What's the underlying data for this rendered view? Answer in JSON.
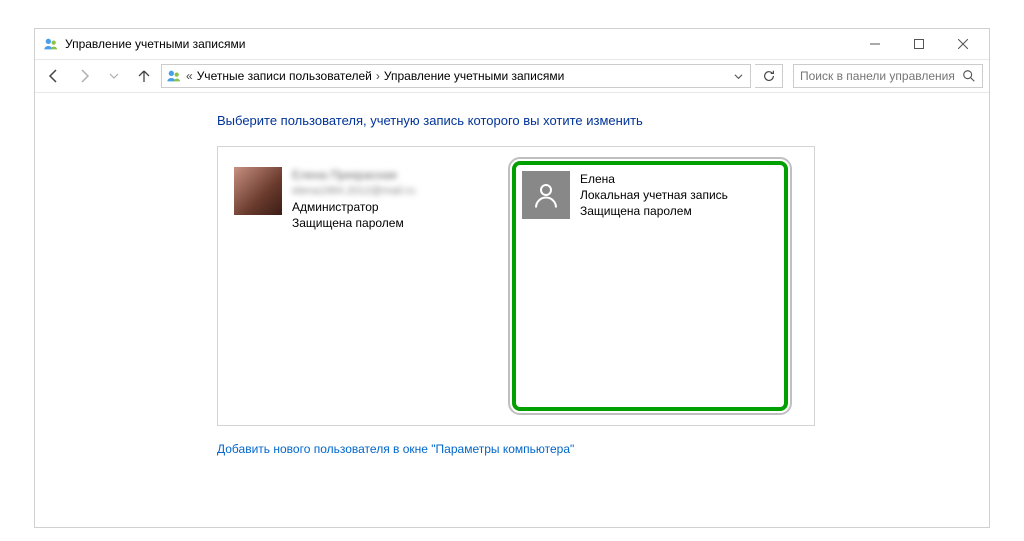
{
  "window": {
    "title": "Управление учетными записями"
  },
  "nav": {
    "breadcrumb_prefix": "«",
    "crumb1": "Учетные записи пользователей",
    "crumb2": "Управление учетными записями"
  },
  "search": {
    "placeholder": "Поиск в панели управления"
  },
  "main": {
    "heading": "Выберите пользователя, учетную запись которого вы хотите изменить",
    "users": [
      {
        "name": "Елена Прекрасная",
        "email": "elena1984.2012@mail.ru",
        "role": "Администратор",
        "protected": "Защищена паролем"
      },
      {
        "name": "Елена",
        "type": "Локальная учетная запись",
        "protected": "Защищена паролем"
      }
    ],
    "add_link": "Добавить нового пользователя в окне \"Параметры компьютера\""
  }
}
